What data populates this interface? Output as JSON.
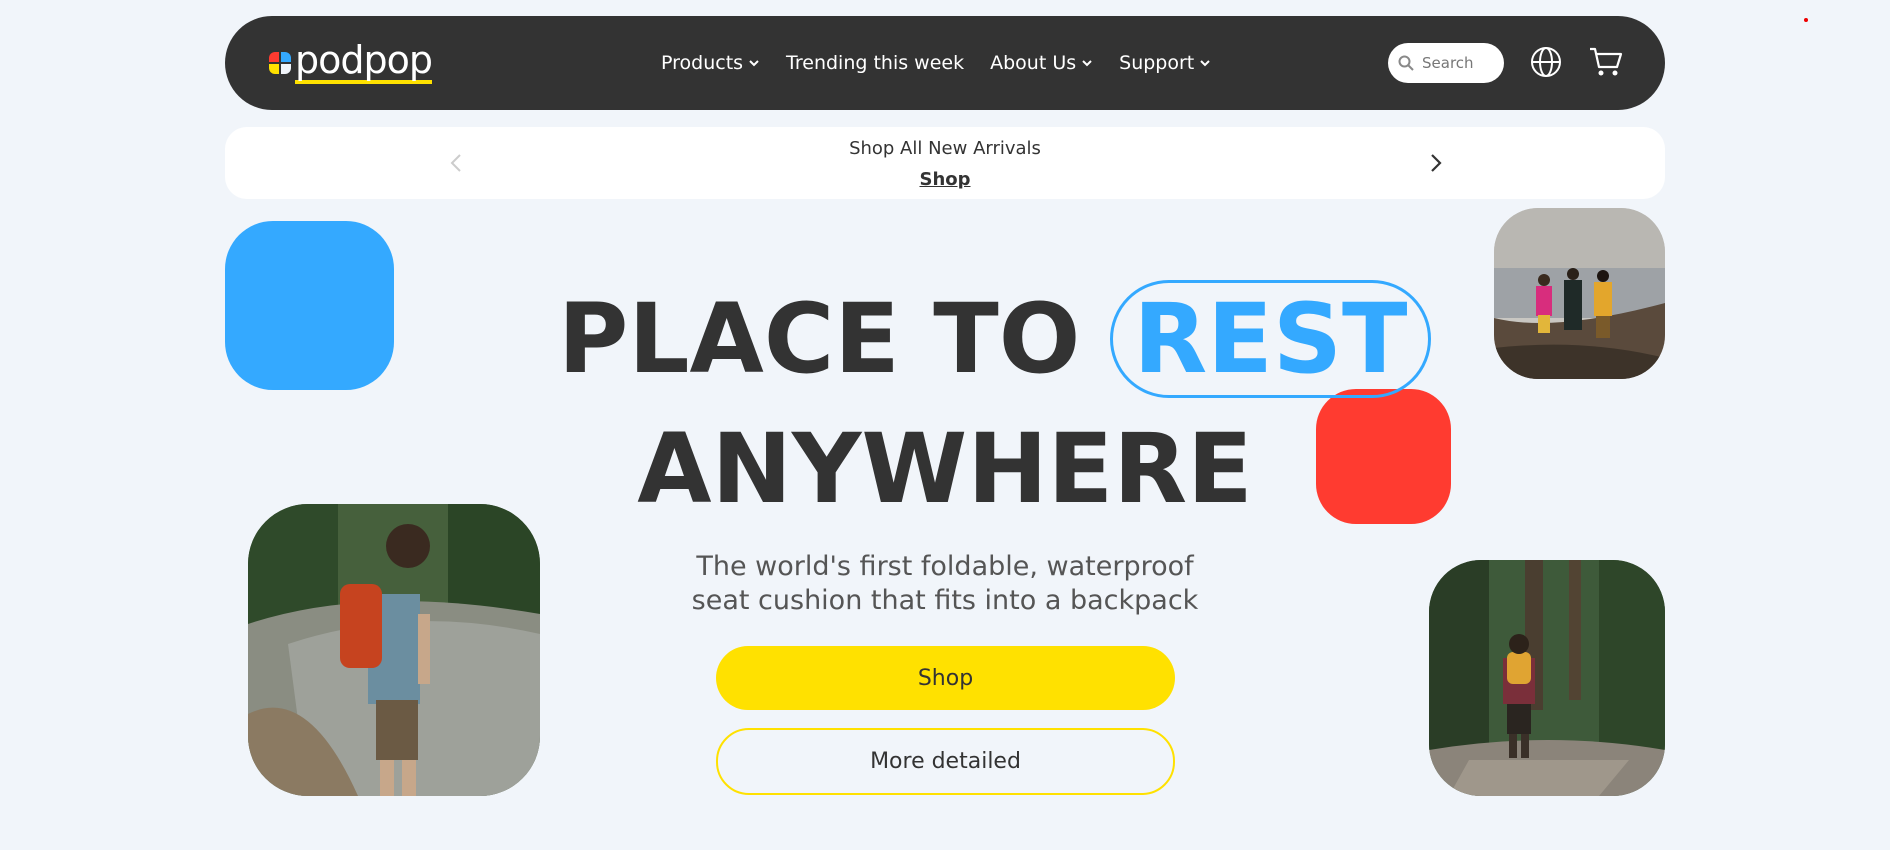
{
  "brand": {
    "name": "podpop",
    "colors": {
      "yellow": "#ffe100",
      "blue": "#34a9ff",
      "red": "#ff3b30",
      "dark": "#333333"
    }
  },
  "nav": {
    "links": [
      {
        "label": "Products",
        "dropdown": true
      },
      {
        "label": "Trending this week",
        "dropdown": false
      },
      {
        "label": "About Us",
        "dropdown": true
      },
      {
        "label": "Support",
        "dropdown": true
      }
    ],
    "search_placeholder": "Search",
    "icons": [
      "search-icon",
      "globe-icon",
      "cart-icon"
    ]
  },
  "announcement": {
    "text": "Shop All New Arrivals",
    "link": "Shop"
  },
  "hero": {
    "line1": "PLACE TO",
    "highlight": "REST",
    "line2": "ANYWHERE",
    "subtitle_1": "The world's first foldable, waterproof",
    "subtitle_2": "seat cushion that fits into a backpack",
    "primary_button": "Shop",
    "secondary_button": "More detailed"
  }
}
